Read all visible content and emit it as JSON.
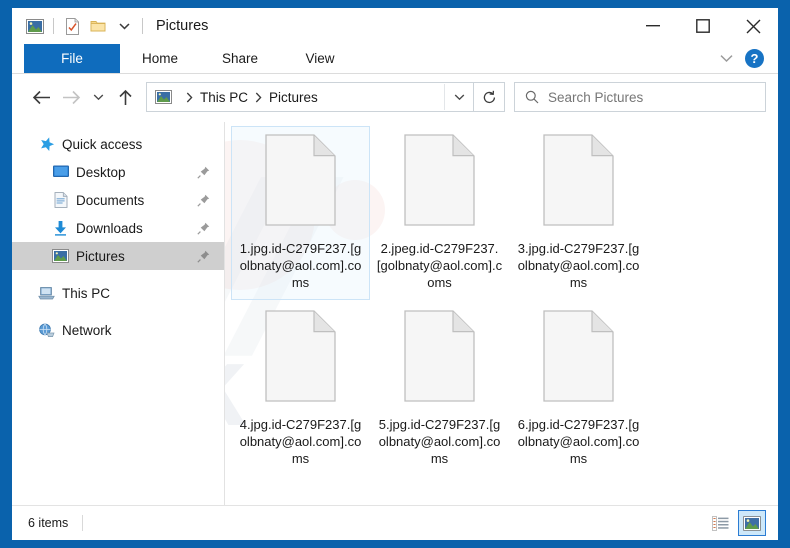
{
  "window": {
    "title": "Pictures",
    "quick_access_icons": [
      "pictures-folder-icon",
      "properties-icon",
      "new-folder-icon",
      "customize-chevron-icon"
    ],
    "controls": {
      "minimize": "–",
      "maximize": "☐",
      "close": "✕",
      "ribbon_expand": "chevron-down-icon",
      "help": "?"
    },
    "border_color": "#0a62ac"
  },
  "ribbon": {
    "tabs": [
      {
        "label": "File",
        "active": true
      },
      {
        "label": "Home",
        "active": false
      },
      {
        "label": "Share",
        "active": false
      },
      {
        "label": "View",
        "active": false
      }
    ],
    "file_tab_color": "#0f6cbd",
    "help_color": "#1773c4"
  },
  "navigation": {
    "back": "back-arrow-icon",
    "forward": "forward-arrow-icon",
    "recent": "recent-locations-chevron-icon",
    "up": "up-arrow-icon",
    "breadcrumb": {
      "icon": "pictures-folder-icon",
      "parts": [
        "This PC",
        "Pictures"
      ],
      "separator": "›",
      "dropdown": "chevron-down-icon"
    },
    "refresh": "refresh-icon"
  },
  "search": {
    "icon": "search-icon",
    "placeholder": "Search Pictures",
    "value": ""
  },
  "sidebar": {
    "items": [
      {
        "label": "Quick access",
        "icon": "star-icon",
        "indent": false,
        "pinned": false,
        "selected": false
      },
      {
        "label": "Desktop",
        "icon": "desktop-icon",
        "indent": true,
        "pinned": true,
        "selected": false
      },
      {
        "label": "Documents",
        "icon": "documents-icon",
        "indent": true,
        "pinned": true,
        "selected": false
      },
      {
        "label": "Downloads",
        "icon": "downloads-icon",
        "indent": true,
        "pinned": true,
        "selected": false
      },
      {
        "label": "Pictures",
        "icon": "pictures-icon",
        "indent": true,
        "pinned": true,
        "selected": true
      },
      {
        "label": "This PC",
        "icon": "this-pc-icon",
        "indent": false,
        "pinned": false,
        "selected": false
      },
      {
        "label": "Network",
        "icon": "network-icon",
        "indent": false,
        "pinned": false,
        "selected": false
      }
    ]
  },
  "files": [
    {
      "name": "1.jpg.id-C279F237.[golbnaty@aol.com].coms",
      "icon": "blank-file-icon",
      "selected": true
    },
    {
      "name": "2.jpeg.id-C279F237.[golbnaty@aol.com].coms",
      "icon": "blank-file-icon",
      "selected": false
    },
    {
      "name": "3.jpg.id-C279F237.[golbnaty@aol.com].coms",
      "icon": "blank-file-icon",
      "selected": false
    },
    {
      "name": "4.jpg.id-C279F237.[golbnaty@aol.com].coms",
      "icon": "blank-file-icon",
      "selected": false
    },
    {
      "name": "5.jpg.id-C279F237.[golbnaty@aol.com].coms",
      "icon": "blank-file-icon",
      "selected": false
    },
    {
      "name": "6.jpg.id-C279F237.[golbnaty@aol.com].coms",
      "icon": "blank-file-icon",
      "selected": false
    }
  ],
  "watermark": {
    "slash": "//",
    "word": "risk"
  },
  "statusbar": {
    "item_count": "6 items",
    "views": [
      {
        "name": "details-view",
        "active": false
      },
      {
        "name": "large-icons-view",
        "active": true
      }
    ],
    "active_highlight": "#cde8fa"
  }
}
